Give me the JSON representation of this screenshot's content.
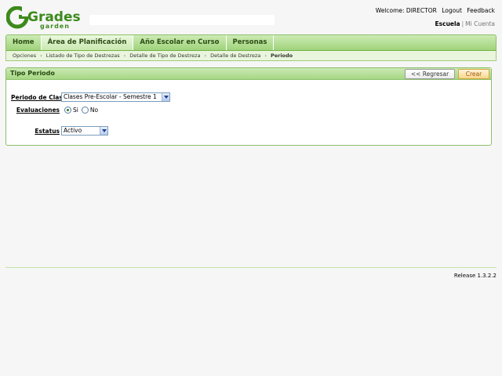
{
  "header": {
    "logo_text_main": "Grades",
    "logo_text_sub": "garden",
    "welcome_text": "Welcome: DIRECTOR",
    "logout_label": "Logout",
    "feedback_label": "Feedback",
    "school_label": "Escuela",
    "separator": "|",
    "account_label": "Mi Cuenta"
  },
  "menu": {
    "tabs": [
      {
        "label": "Home"
      },
      {
        "label": "Área de Planificación"
      },
      {
        "label": "Año Escolar en Curso"
      },
      {
        "label": "Personas"
      }
    ],
    "active_tab": "Área de Planificación"
  },
  "breadcrumb": {
    "items": [
      "Opciones",
      "Listado de Tipo de Destrezas",
      "Detalle de Tipo de Destreza",
      "Detalle de Destreza"
    ],
    "separator": "›",
    "current": "Periodo"
  },
  "panel": {
    "title": "Tipo Periodo",
    "back_label": "<< Regresar",
    "create_label": "Crear"
  },
  "form": {
    "periodo_label": "Periodo de Clase",
    "periodo_value": "Clases Pre-Escolar - Semestre 1",
    "evaluaciones_label": "Evaluaciones",
    "evaluaciones_options": [
      "Si",
      "No"
    ],
    "evaluaciones_selected": "Si",
    "estatus_label": "Estatus",
    "estatus_value": "Activo"
  },
  "footer": {
    "release_text": "Release 1.3.2.2"
  },
  "colors": {
    "brand_green": "#3d8a1c",
    "menu_green": "#9fd37a",
    "create_button": "#f7d68a"
  },
  "icons": {
    "select_arrow": "chevron-down-icon",
    "radio": "radio-icon"
  }
}
